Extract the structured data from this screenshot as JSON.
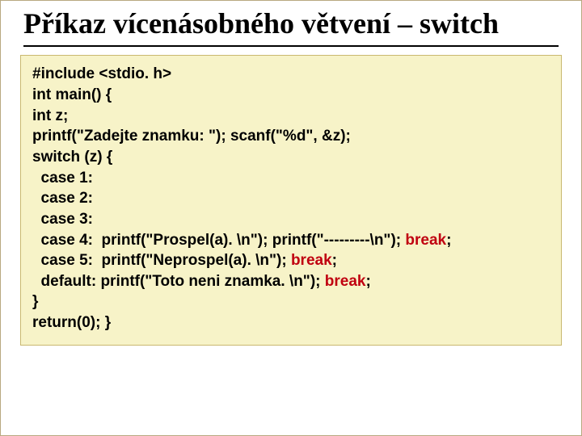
{
  "title": "Příkaz vícenásobného větvení – switch",
  "code": {
    "l1": "#include <stdio. h>",
    "l2": "int main() {",
    "l3": "int z;",
    "l4": "printf(\"Zadejte znamku: \"); scanf(\"%d\", &z);",
    "l5": "switch (z) {",
    "l6": "  case 1:",
    "l7": "  case 2:",
    "l8": "  case 3:",
    "l9a": "  case 4:  printf(\"Prospel(a). \\n\"); printf(\"---------\\n\"); ",
    "l9b": "break",
    "l9c": ";",
    "l10a": "  case 5:  printf(\"Neprospel(a). \\n\"); ",
    "l10b": "break",
    "l10c": ";",
    "l11a": "  default: printf(\"Toto neni znamka. \\n\"); ",
    "l11b": "break",
    "l11c": ";",
    "l12": "}",
    "l13": "return(0); }"
  }
}
